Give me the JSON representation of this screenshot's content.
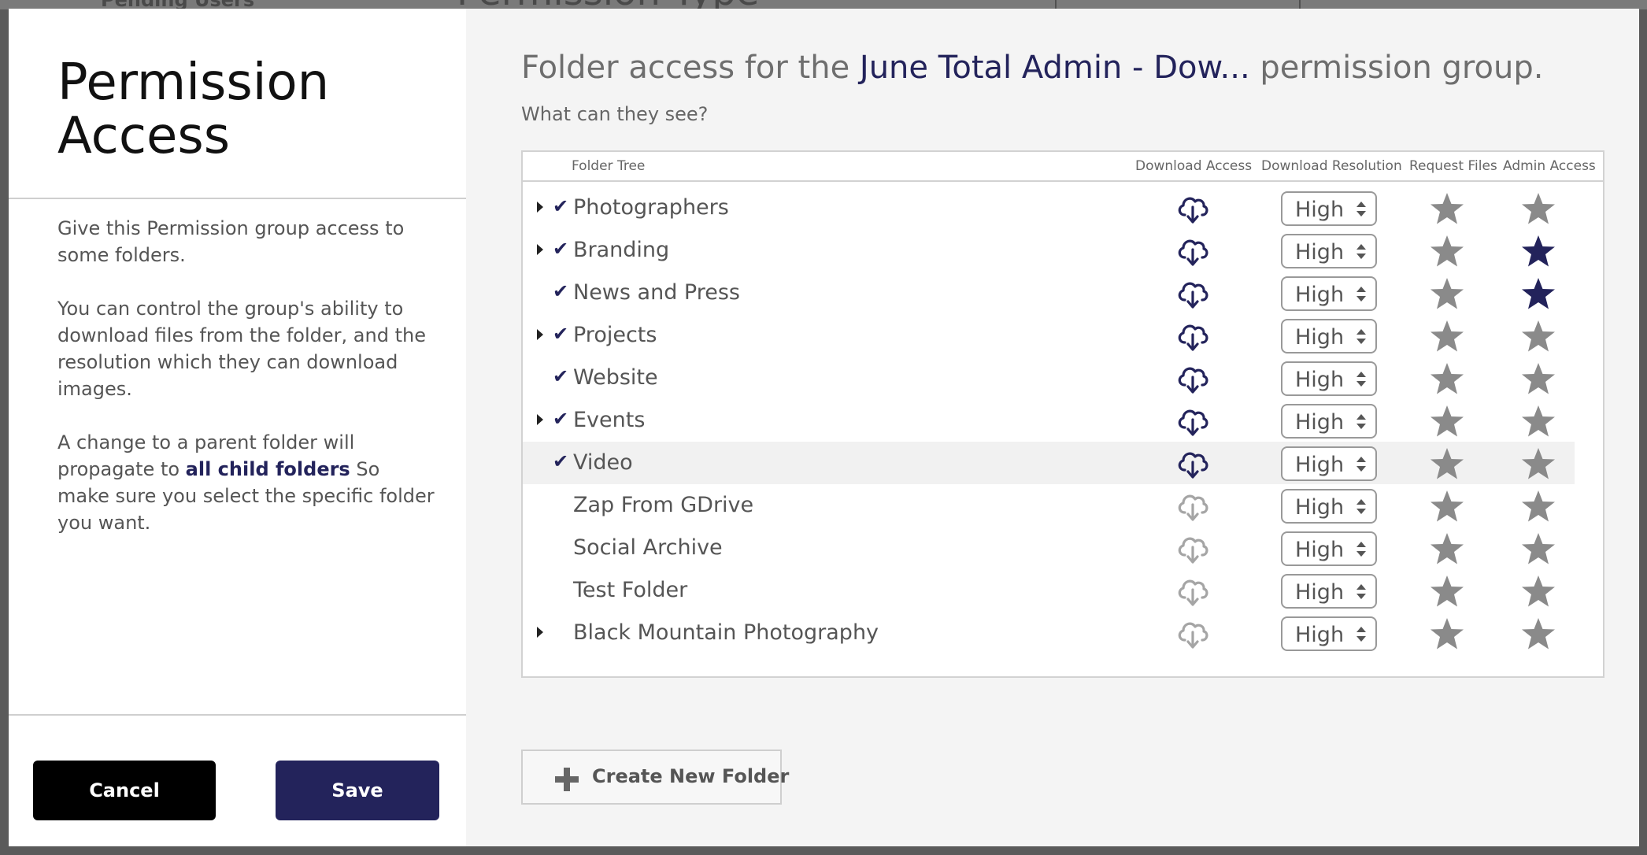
{
  "background": {
    "left_text": "Pending Users",
    "center_text": "Permission Type"
  },
  "sidebar": {
    "title_line1": "Permission",
    "title_line2": "Access",
    "para1": "Give this Permission group access to some folders.",
    "para2": "You can control the group's ability to download files from the folder, and the resolution which they can download images.",
    "para3_before": "A change to a parent folder will propagate to ",
    "para3_bold": "all child folders",
    "para3_after": " So make sure you select the specific folder you want.",
    "cancel_label": "Cancel",
    "save_label": "Save"
  },
  "main": {
    "heading_before": "Folder access for the ",
    "group_name": "June Total Admin - Dow...",
    "heading_after": " permission group.",
    "subheading": "What can they see?",
    "columns": {
      "folder_tree": "Folder Tree",
      "download_access": "Download Access",
      "download_resolution": "Download Resolution",
      "request_files": "Request Files",
      "admin_access": "Admin Access"
    },
    "rows": [
      {
        "name": "Photographers",
        "expandable": true,
        "checked": true,
        "download": true,
        "resolution": "High",
        "request": false,
        "admin": false
      },
      {
        "name": "Branding",
        "expandable": true,
        "checked": true,
        "download": true,
        "resolution": "High",
        "request": false,
        "admin": true
      },
      {
        "name": "News and Press",
        "expandable": false,
        "checked": true,
        "download": true,
        "resolution": "High",
        "request": false,
        "admin": true
      },
      {
        "name": "Projects",
        "expandable": true,
        "checked": true,
        "download": true,
        "resolution": "High",
        "request": false,
        "admin": false
      },
      {
        "name": "Website",
        "expandable": false,
        "checked": true,
        "download": true,
        "resolution": "High",
        "request": false,
        "admin": false
      },
      {
        "name": "Events",
        "expandable": true,
        "checked": true,
        "download": true,
        "resolution": "High",
        "request": false,
        "admin": false
      },
      {
        "name": "Video",
        "expandable": false,
        "checked": true,
        "download": true,
        "resolution": "High",
        "request": false,
        "admin": false,
        "highlighted": true
      },
      {
        "name": "Zap From GDrive",
        "expandable": false,
        "checked": false,
        "download": false,
        "resolution": "High",
        "request": false,
        "admin": false
      },
      {
        "name": "Social Archive",
        "expandable": false,
        "checked": false,
        "download": false,
        "resolution": "High",
        "request": false,
        "admin": false
      },
      {
        "name": "Test Folder",
        "expandable": false,
        "checked": false,
        "download": false,
        "resolution": "High",
        "request": false,
        "admin": false
      },
      {
        "name": "Black Mountain Photography",
        "expandable": true,
        "checked": false,
        "download": false,
        "resolution": "High",
        "request": false,
        "admin": false
      }
    ],
    "check_glyph": "✔",
    "create_folder_label": "Create New Folder"
  },
  "icons": {
    "checkmark": "check-icon",
    "expand": "caret-right-icon",
    "download": "cloud-download-icon",
    "star": "star-icon",
    "plus": "plus-icon"
  },
  "colors": {
    "brand": "#23235b",
    "active_icon": "#23235b",
    "inactive_icon": "#a5a5a5",
    "star_off": "#8a8a8a",
    "star_on": "#23235b",
    "cancel_bg": "#000000",
    "save_bg": "#23235b"
  }
}
